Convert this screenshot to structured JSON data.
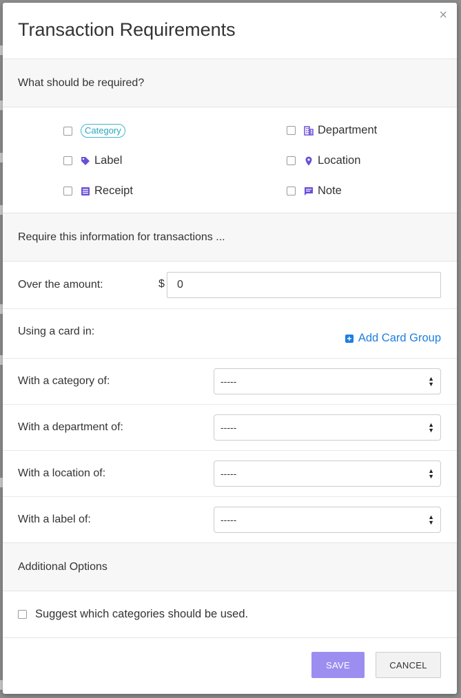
{
  "modal": {
    "title": "Transaction Requirements",
    "close_glyph": "×"
  },
  "required": {
    "heading": "What should be required?",
    "items": [
      {
        "label": "Category",
        "icon": "tag-pill",
        "checked": false
      },
      {
        "label": "Department",
        "icon": "building-icon",
        "checked": false
      },
      {
        "label": "Label",
        "icon": "label-icon",
        "checked": false
      },
      {
        "label": "Location",
        "icon": "map-pin-icon",
        "checked": false
      },
      {
        "label": "Receipt",
        "icon": "receipt-icon",
        "checked": false
      },
      {
        "label": "Note",
        "icon": "comment-icon",
        "checked": false
      }
    ]
  },
  "conditions": {
    "heading": "Require this information for transactions ...",
    "amount_label": "Over the amount:",
    "currency": "$",
    "amount_value": "0",
    "card_label": "Using a card in:",
    "add_card_group": "Add Card Group",
    "category_label": "With a category of:",
    "category_value": "-----",
    "department_label": "With a department of:",
    "department_value": "-----",
    "location_label": "With a location of:",
    "location_value": "-----",
    "label_label": "With a label of:",
    "label_value": "-----"
  },
  "additional": {
    "heading": "Additional Options",
    "suggest_label": "Suggest which categories should be used."
  },
  "footer": {
    "save": "SAVE",
    "cancel": "CANCEL"
  },
  "colors": {
    "accent": "#6b4fd8",
    "link": "#1d7fe0",
    "tag": "#2aa7bb",
    "save_button": "#9b8ef0"
  }
}
